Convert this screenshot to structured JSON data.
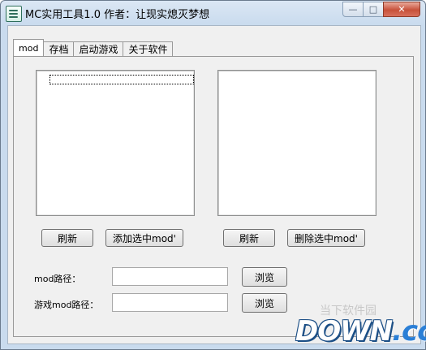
{
  "window": {
    "title": "MC实用工具1.0    作者：让现实熄灭梦想",
    "min": "—",
    "max": "□",
    "close": "✕"
  },
  "tabs": [
    {
      "label": "mod"
    },
    {
      "label": "存档"
    },
    {
      "label": "启动游戏"
    },
    {
      "label": "关于软件"
    }
  ],
  "buttons": {
    "refresh_left": "刷新",
    "add_mod": "添加选中mod'",
    "refresh_right": "刷新",
    "delete_mod": "删除选中mod'",
    "browse_mod": "浏览",
    "browse_game": "浏览"
  },
  "fields": {
    "mod_path_label": "mod路径：",
    "mod_path_value": "",
    "game_mod_path_label": "游戏mod路径：",
    "game_mod_path_value": ""
  },
  "watermark": {
    "main": "DOWN",
    "suffix": ".cc",
    "top": "当下软件园"
  }
}
